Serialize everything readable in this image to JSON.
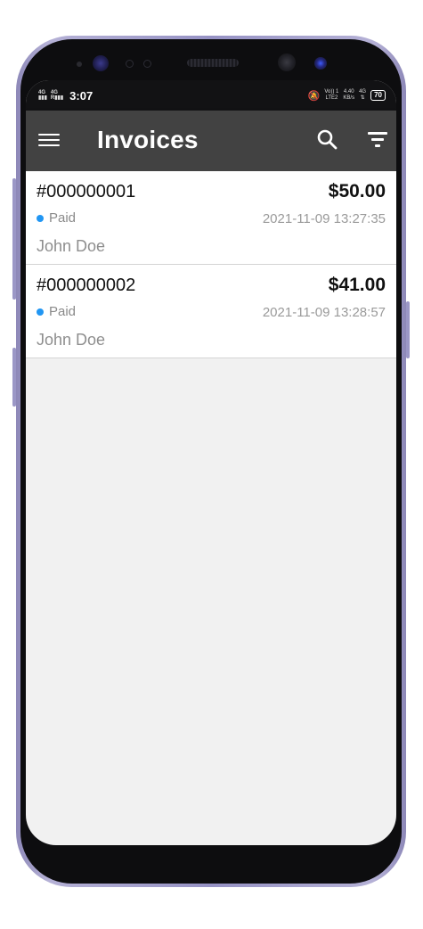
{
  "status_bar": {
    "net1": "4G",
    "net2": "4G",
    "time": "3:07",
    "volte": "Vo)) 1",
    "lte": "LTE2",
    "speed": "4.40",
    "speed_unit": "KB/s",
    "net3": "4G",
    "battery": "70"
  },
  "app_bar": {
    "title": "Invoices",
    "menu_icon": "menu-icon",
    "search_icon": "search-icon",
    "filter_icon": "filter-icon"
  },
  "colors": {
    "app_bar": "#424242",
    "status_dot": "#2196f3"
  },
  "invoices": [
    {
      "number": "#000000001",
      "amount": "$50.00",
      "status": "Paid",
      "date": "2021-11-09 13:27:35",
      "customer": "John Doe"
    },
    {
      "number": "#000000002",
      "amount": "$41.00",
      "status": "Paid",
      "date": "2021-11-09 13:28:57",
      "customer": "John Doe"
    }
  ]
}
